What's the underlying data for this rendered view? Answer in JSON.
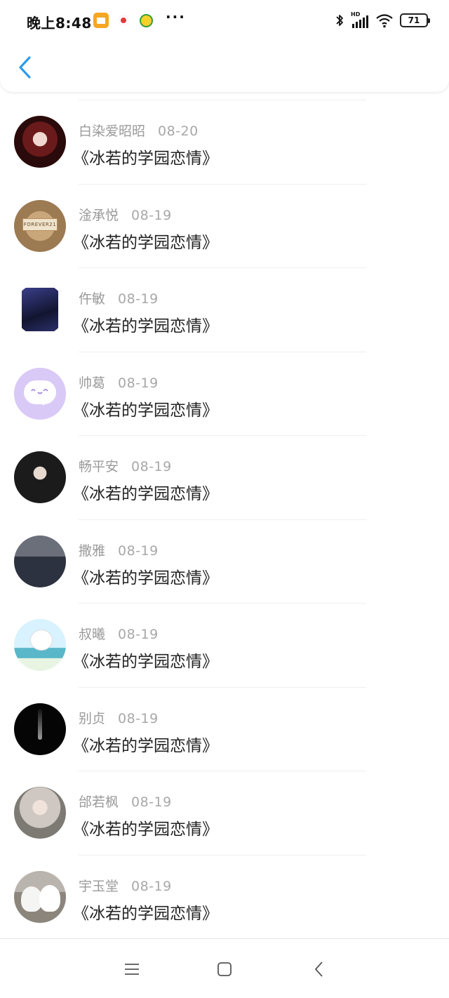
{
  "status_bar": {
    "time": "晚上8:48",
    "more": "···",
    "battery": "71",
    "signal_label": "HD"
  },
  "header": {
    "back_icon": "chevron-left-icon"
  },
  "list": {
    "items": [
      {
        "name": "白染爱昭昭",
        "date": "08-20",
        "title": "《冰若的学园恋情》"
      },
      {
        "name": "淦承悦",
        "date": "08-19",
        "title": "《冰若的学园恋情》"
      },
      {
        "name": "仵敏",
        "date": "08-19",
        "title": "《冰若的学园恋情》"
      },
      {
        "name": "帅葛",
        "date": "08-19",
        "title": "《冰若的学园恋情》"
      },
      {
        "name": "畅平安",
        "date": "08-19",
        "title": "《冰若的学园恋情》"
      },
      {
        "name": "撒雅",
        "date": "08-19",
        "title": "《冰若的学园恋情》"
      },
      {
        "name": "叔曦",
        "date": "08-19",
        "title": "《冰若的学园恋情》"
      },
      {
        "name": "别贞",
        "date": "08-19",
        "title": "《冰若的学园恋情》"
      },
      {
        "name": "邰若枫",
        "date": "08-19",
        "title": "《冰若的学园恋情》"
      },
      {
        "name": "宇玉堂",
        "date": "08-19",
        "title": "《冰若的学园恋情》"
      }
    ],
    "avatar_tag_text": "FOREVER21"
  },
  "nav_bar": {
    "menu_icon": "menu-icon",
    "home_icon": "square-home-icon",
    "back_icon": "triangle-back-icon"
  },
  "colors": {
    "accent": "#2f9bea",
    "name_text": "#9a9a9a",
    "title_text": "#222222"
  }
}
